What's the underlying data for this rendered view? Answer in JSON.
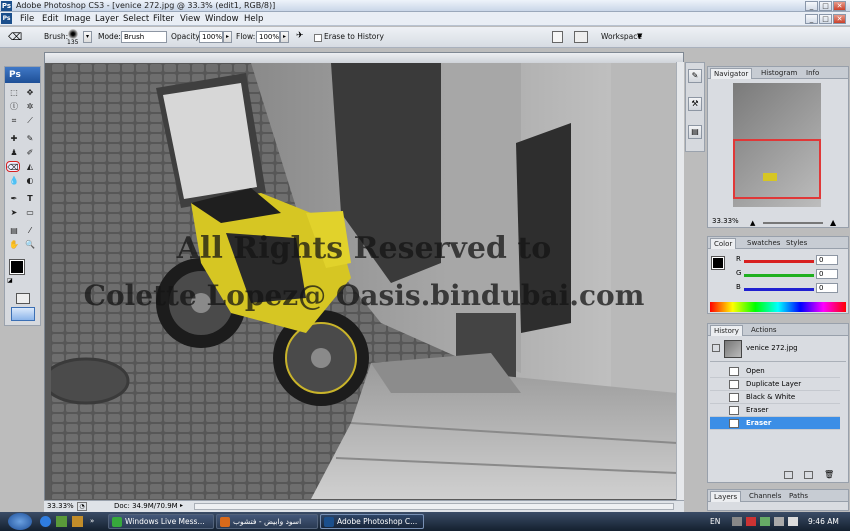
{
  "app": {
    "title": "Adobe Photoshop CS3 - [venice 272.jpg @ 33.3% (edit1, RGB/8)]",
    "logo": "Ps",
    "window_controls": [
      "_",
      "□",
      "✕"
    ],
    "doc_controls": [
      "_",
      "□",
      "✕"
    ]
  },
  "menu": [
    "File",
    "Edit",
    "Image",
    "Layer",
    "Select",
    "Filter",
    "View",
    "Window",
    "Help"
  ],
  "options": {
    "brush_label": "Brush:",
    "brush_size": "135",
    "mode_label": "Mode:",
    "mode_value": "Brush",
    "opacity_label": "Opacity:",
    "opacity_value": "100%",
    "flow_label": "Flow:",
    "flow_value": "100%",
    "erase_to_history": "Erase to History",
    "workspace": "Workspace"
  },
  "toolbox": {
    "logo": "Ps"
  },
  "canvas": {
    "watermark_line1": "All Rights Reserved to",
    "watermark_line2": "Colette Lopez@ Oasis.bindubai.com"
  },
  "status": {
    "zoom": "33.33%",
    "doc": "Doc: 34.9M/70.9M"
  },
  "navigator": {
    "tabs": [
      "Navigator",
      "Histogram",
      "Info"
    ],
    "zoom": "33.33%"
  },
  "color": {
    "tabs": [
      "Color",
      "Swatches",
      "Styles"
    ],
    "channels": [
      {
        "label": "R",
        "value": "0",
        "color": "#e02020"
      },
      {
        "label": "G",
        "value": "0",
        "color": "#20b020"
      },
      {
        "label": "B",
        "value": "0",
        "color": "#2020d0"
      }
    ]
  },
  "history": {
    "tabs": [
      "History",
      "Actions"
    ],
    "snapshot": "venice 272.jpg",
    "states": [
      "Open",
      "Duplicate Layer",
      "Black & White",
      "Eraser",
      "Eraser"
    ]
  },
  "layers": {
    "tabs": [
      "Layers",
      "Channels",
      "Paths"
    ]
  },
  "taskbar": {
    "items": [
      "Windows Live Mess...",
      "اسود وابيض - فتشوب",
      "Adobe Photoshop C..."
    ],
    "lang": "EN",
    "time": "9:46 AM"
  }
}
